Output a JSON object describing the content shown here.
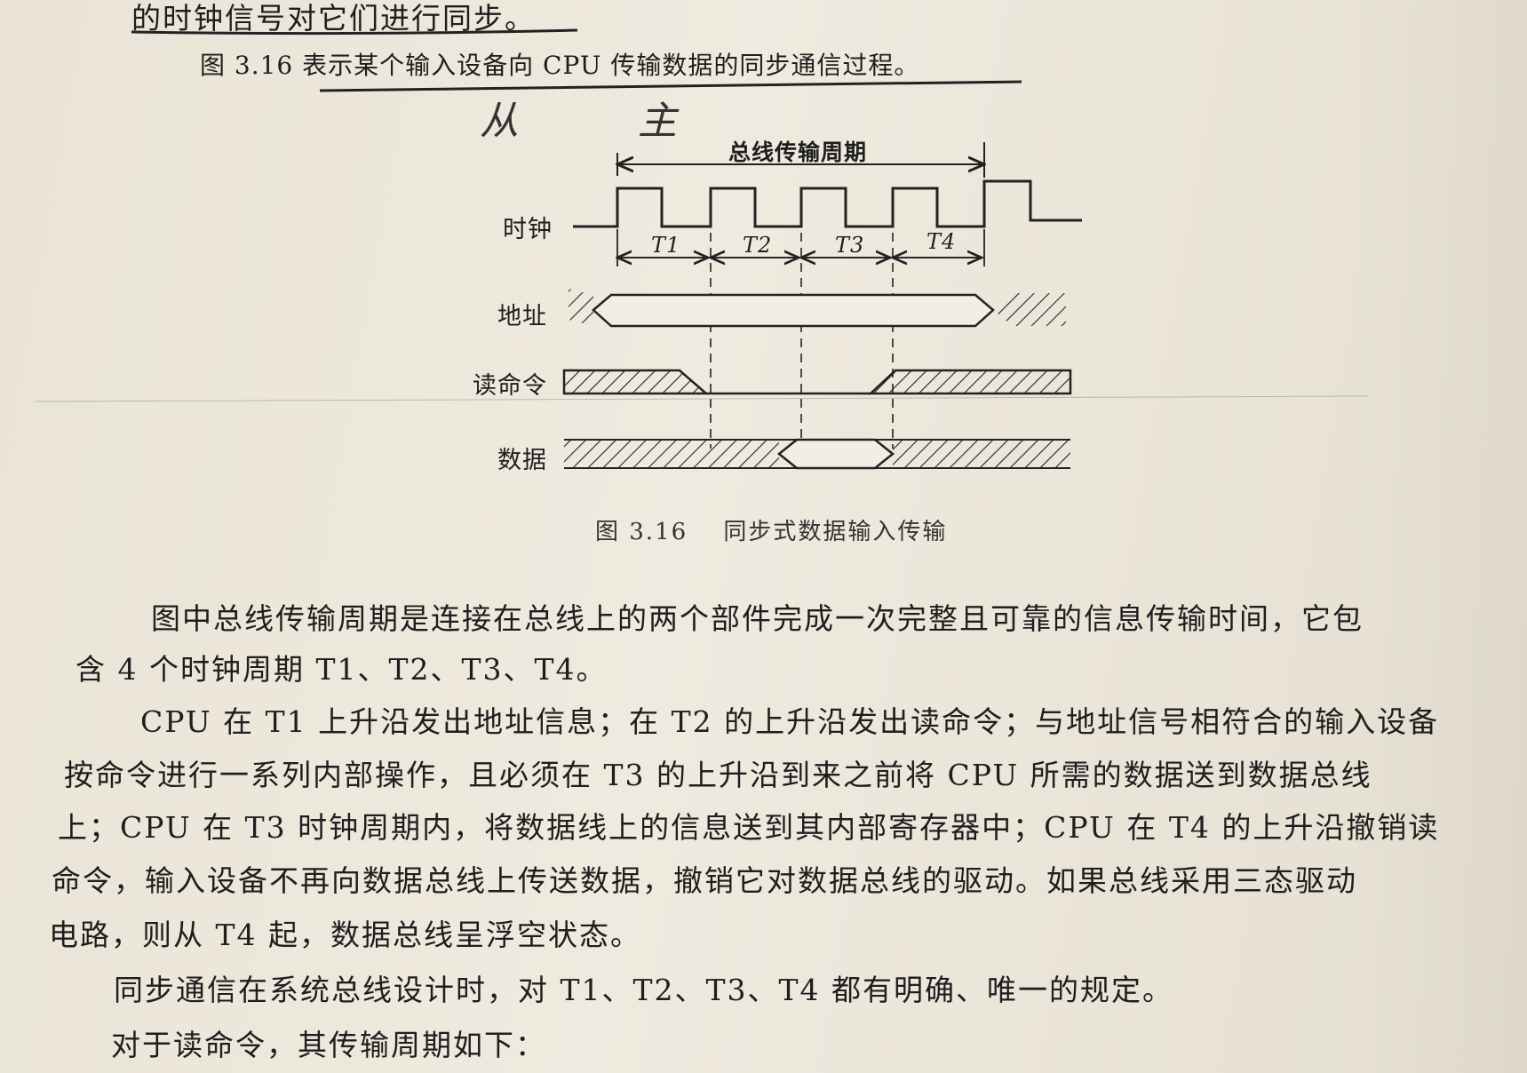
{
  "header": {
    "line_top": "的时钟信号对它们进行同步。",
    "line_intro": "图 3.16 表示某个输入设备向 CPU 传输数据的同步通信过程。"
  },
  "handwriting": {
    "note": "从 主"
  },
  "figure": {
    "period_label": "总线传输周期",
    "signals": {
      "clock": "时钟",
      "address": "地址",
      "read_cmd": "读命令",
      "data": "数据"
    },
    "clock_labels": [
      "T1",
      "T2",
      "T3",
      "T4"
    ],
    "caption_number": "图 3.16",
    "caption_text": "同步式数据输入传输"
  },
  "body": {
    "p1_line1": "图中总线传输周期是连接在总线上的两个部件完成一次完整且可靠的信息传输时间，它包",
    "p1_line2": "含 4 个时钟周期 T1、T2、T3、T4。",
    "p2_line1": "CPU 在 T1 上升沿发出地址信息；在 T2 的上升沿发出读命令；与地址信号相符合的输入设备",
    "p2_line2": "按命令进行一系列内部操作，且必须在 T3 的上升沿到来之前将 CPU 所需的数据送到数据总线",
    "p2_line3": "上；CPU 在 T3 时钟周期内，将数据线上的信息送到其内部寄存器中；CPU 在 T4 的上升沿撤销读",
    "p2_line4": "命令，输入设备不再向数据总线上传送数据，撤销它对数据总线的驱动。如果总线采用三态驱动",
    "p2_line5": "电路，则从 T4 起，数据总线呈浮空状态。",
    "p3": "同步通信在系统总线设计时，对 T1、T2、T3、T4 都有明确、唯一的规定。",
    "p4": "对于读命令，其传输周期如下："
  }
}
